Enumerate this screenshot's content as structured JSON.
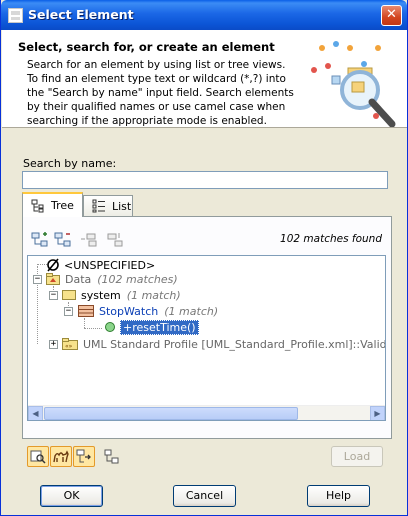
{
  "window": {
    "title": "Select Element",
    "close_glyph": "✕"
  },
  "header": {
    "title": "Select, search for, or create an element",
    "description": "Search for an element by using list or tree views. To find an element type text or wildcard (*,?) into the \"Search by name\" input field. Search elements by their qualified names or use camel case when searching if the appropriate mode is enabled.",
    "art_icon": "magnifier-diagram-icon"
  },
  "search": {
    "label": "Search by name:",
    "value": "",
    "placeholder": ""
  },
  "tabs": [
    {
      "label": "Tree",
      "icon": "tree-icon",
      "active": true
    },
    {
      "label": "List",
      "icon": "list-icon",
      "active": false
    }
  ],
  "panel": {
    "toolbar": [
      "expand-icon",
      "collapse-icon",
      "move-up-icon",
      "move-down-icon"
    ],
    "matches_text": "102 matches found"
  },
  "tree": {
    "unspecified": "<UNSPECIFIED>",
    "data": {
      "label": "Data",
      "count": "(102 matches)"
    },
    "system": {
      "label": "system",
      "count": "(1 match)"
    },
    "stopwatch": {
      "label": "StopWatch",
      "count": "(1 match)"
    },
    "reset": {
      "label": "+resetTime()"
    },
    "uml_profile": {
      "label": "UML Standard Profile [UML_Standard_Profile.xml]::Validation Pr"
    }
  },
  "bottom": {
    "load_label": "Load"
  },
  "buttons": {
    "ok": "OK",
    "cancel": "Cancel",
    "help": "Help"
  },
  "colors": {
    "titlebar": "#0A5FE6",
    "selection": "#316AC5",
    "accent_tab": "#FFC83C"
  }
}
